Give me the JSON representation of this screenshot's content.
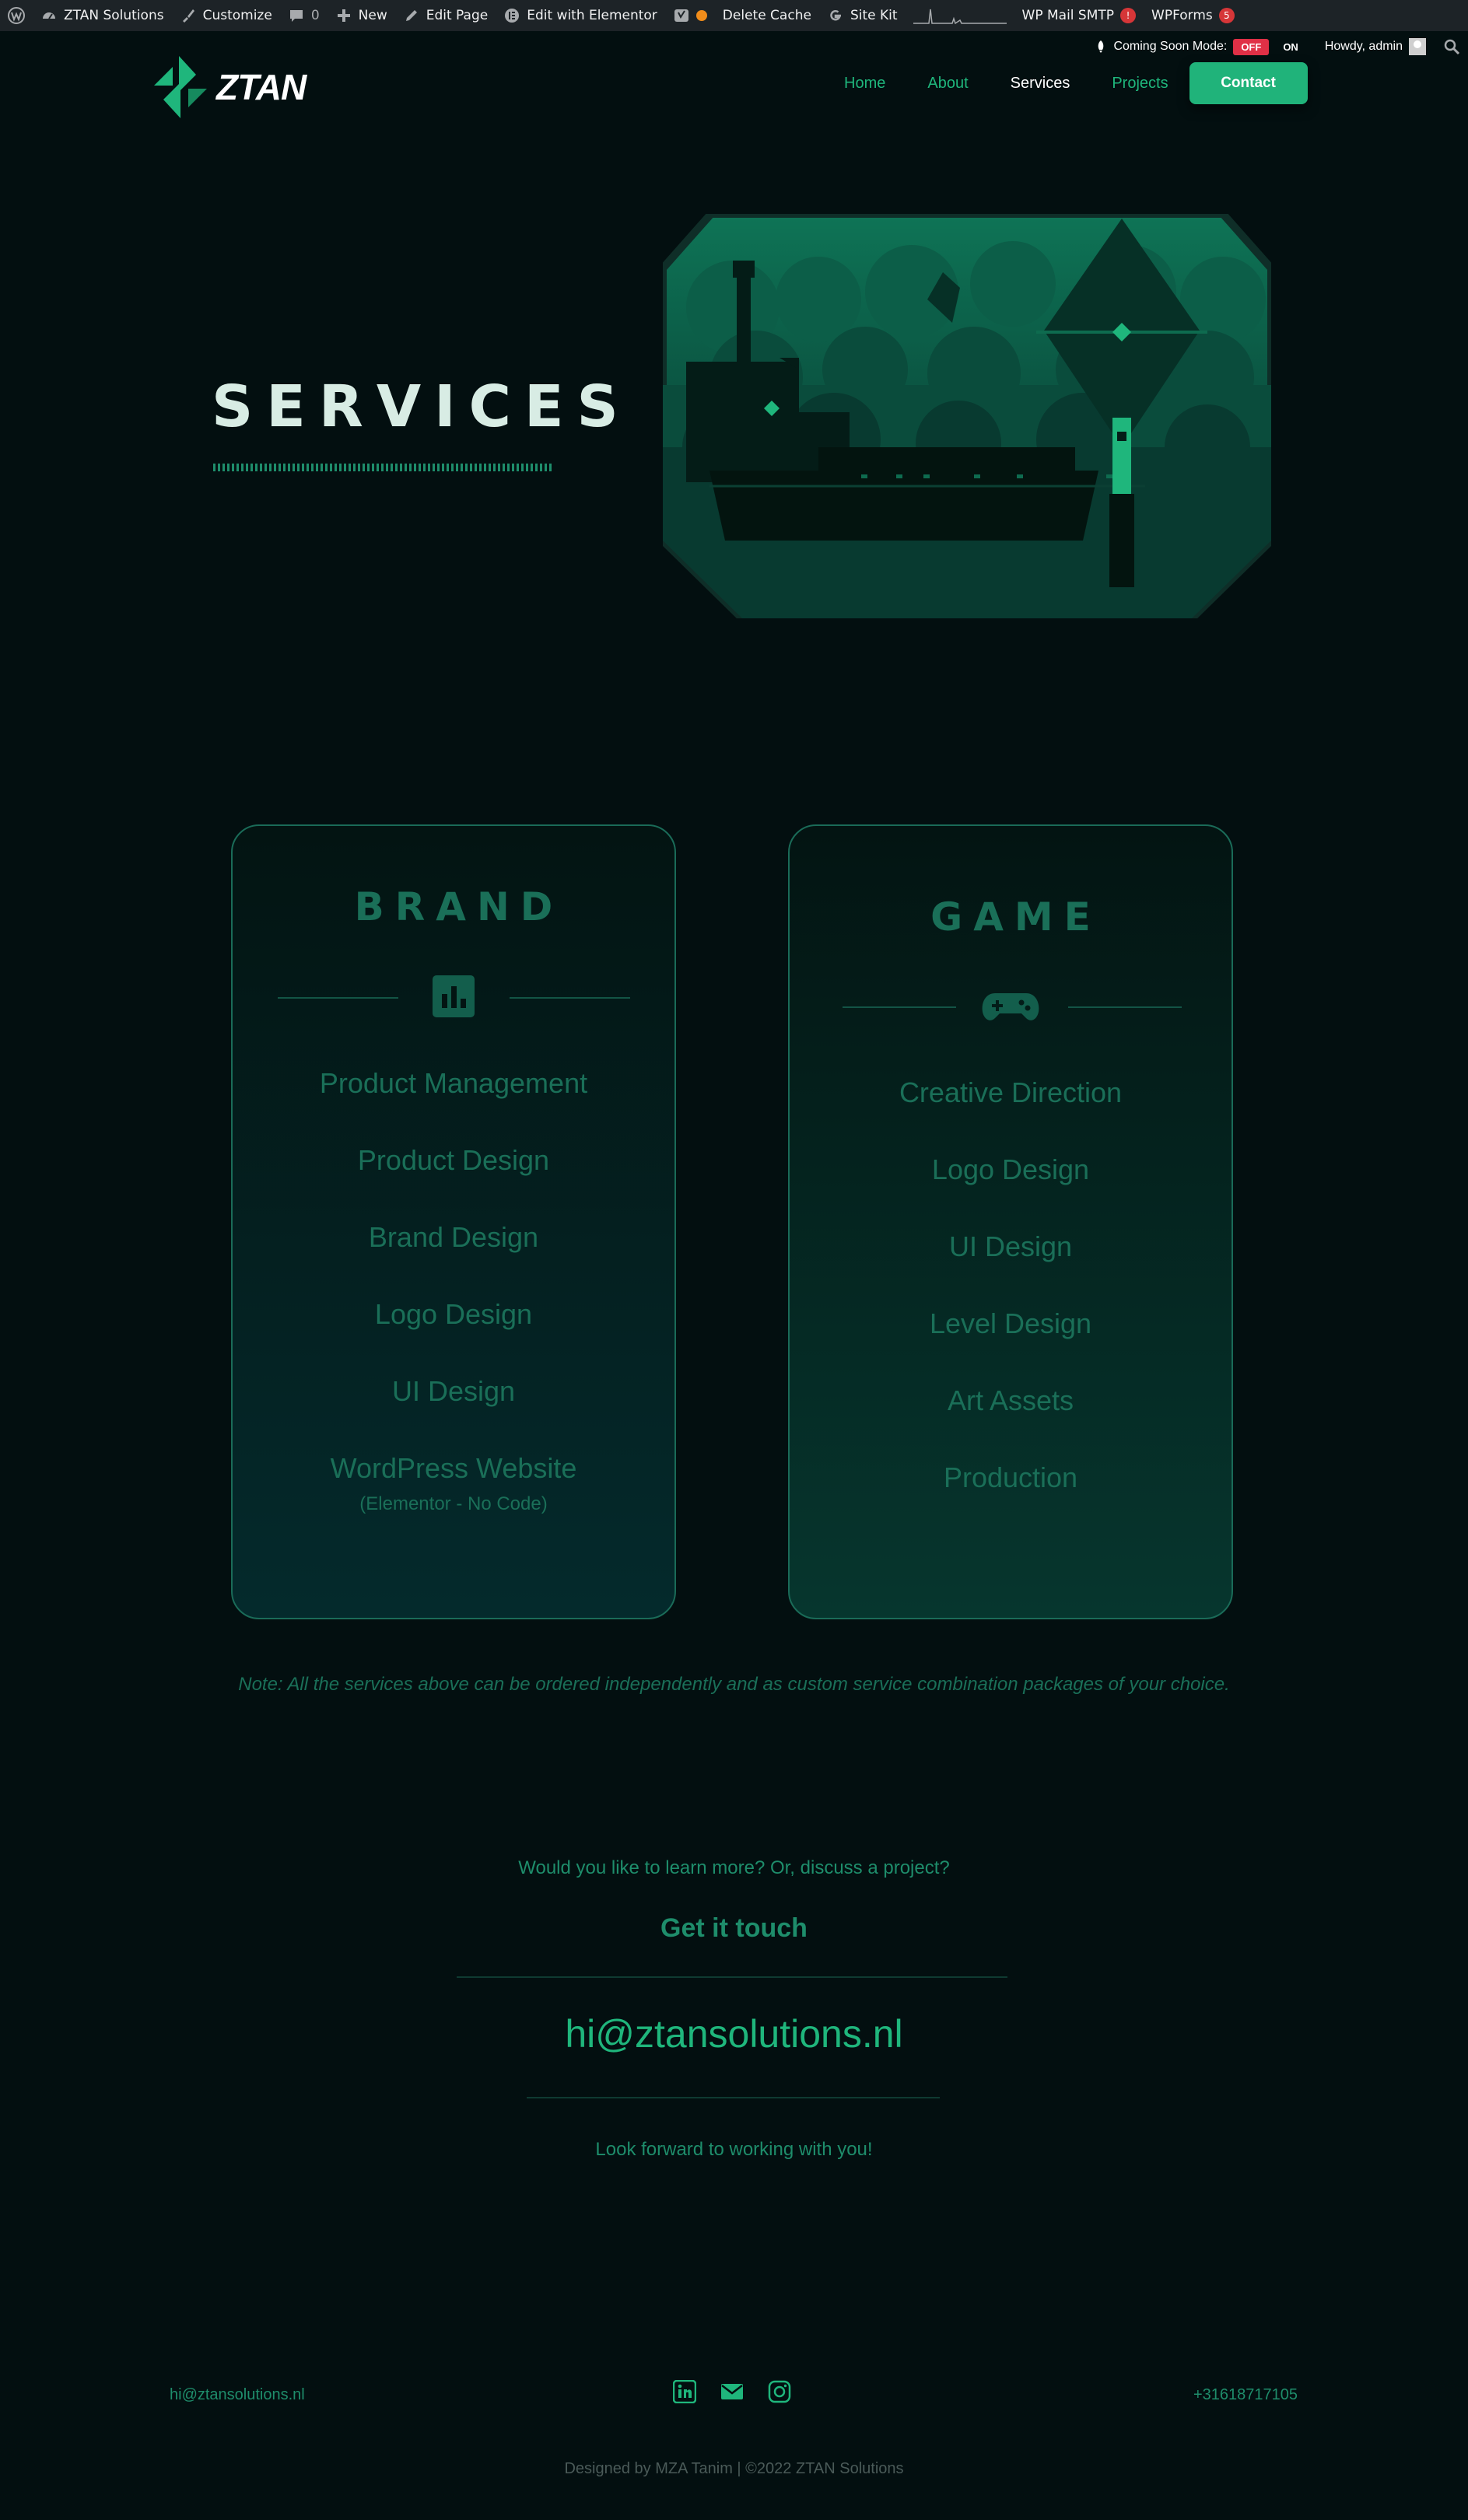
{
  "admin_bar": {
    "site_name": "ZTAN Solutions",
    "customize": "Customize",
    "comments_count": "0",
    "new": "New",
    "edit_page": "Edit Page",
    "edit_elementor": "Edit with Elementor",
    "delete_cache": "Delete Cache",
    "site_kit": "Site Kit",
    "wp_mail_smtp": "WP Mail SMTP",
    "wp_mail_smtp_badge": "!",
    "wpforms": "WPForms",
    "wpforms_badge": "5",
    "coming_soon_label": "Coming Soon Mode:",
    "coming_soon_off": "OFF",
    "coming_soon_on": "ON",
    "howdy": "Howdy, admin"
  },
  "header": {
    "logo_text": "ZTAN",
    "nav": [
      {
        "label": "Home",
        "active": false
      },
      {
        "label": "About",
        "active": false
      },
      {
        "label": "Services",
        "active": true
      },
      {
        "label": "Projects",
        "active": false
      }
    ],
    "contact_button": "Contact"
  },
  "hero": {
    "title": "SERVICES"
  },
  "cards": {
    "brand": {
      "title": "BRAND",
      "icon": "bar-chart-icon",
      "items": [
        "Product Management",
        "Product Design",
        "Brand Design",
        "Logo Design",
        "UI Design",
        "WordPress Website"
      ],
      "last_item_sub": "(Elementor - No Code)"
    },
    "game": {
      "title": "GAME",
      "icon": "gamepad-icon",
      "items": [
        "Creative Direction",
        "Logo Design",
        "UI Design",
        "Level Design",
        "Art Assets",
        "Production"
      ]
    }
  },
  "note": "Note: All the services above can be ordered independently and as custom service combination packages of your choice.",
  "contact": {
    "learn_more": "Would you like to learn more? Or, discuss a project?",
    "get_in_touch": "Get it touch",
    "email": "hi@ztansolutions.nl",
    "look_forward": "Look forward to working with you!"
  },
  "footer": {
    "email": "hi@ztansolutions.nl",
    "phone": "+31618717105",
    "social": [
      "linkedin-icon",
      "envelope-icon",
      "instagram-icon"
    ],
    "credits": "Designed by MZA Tanim  |  ©2022 ZTAN Solutions"
  },
  "colors": {
    "background": "#030f10",
    "accent": "#1fb67c",
    "muted_green": "#1a6f58",
    "admin_bar": "#1d2327"
  }
}
